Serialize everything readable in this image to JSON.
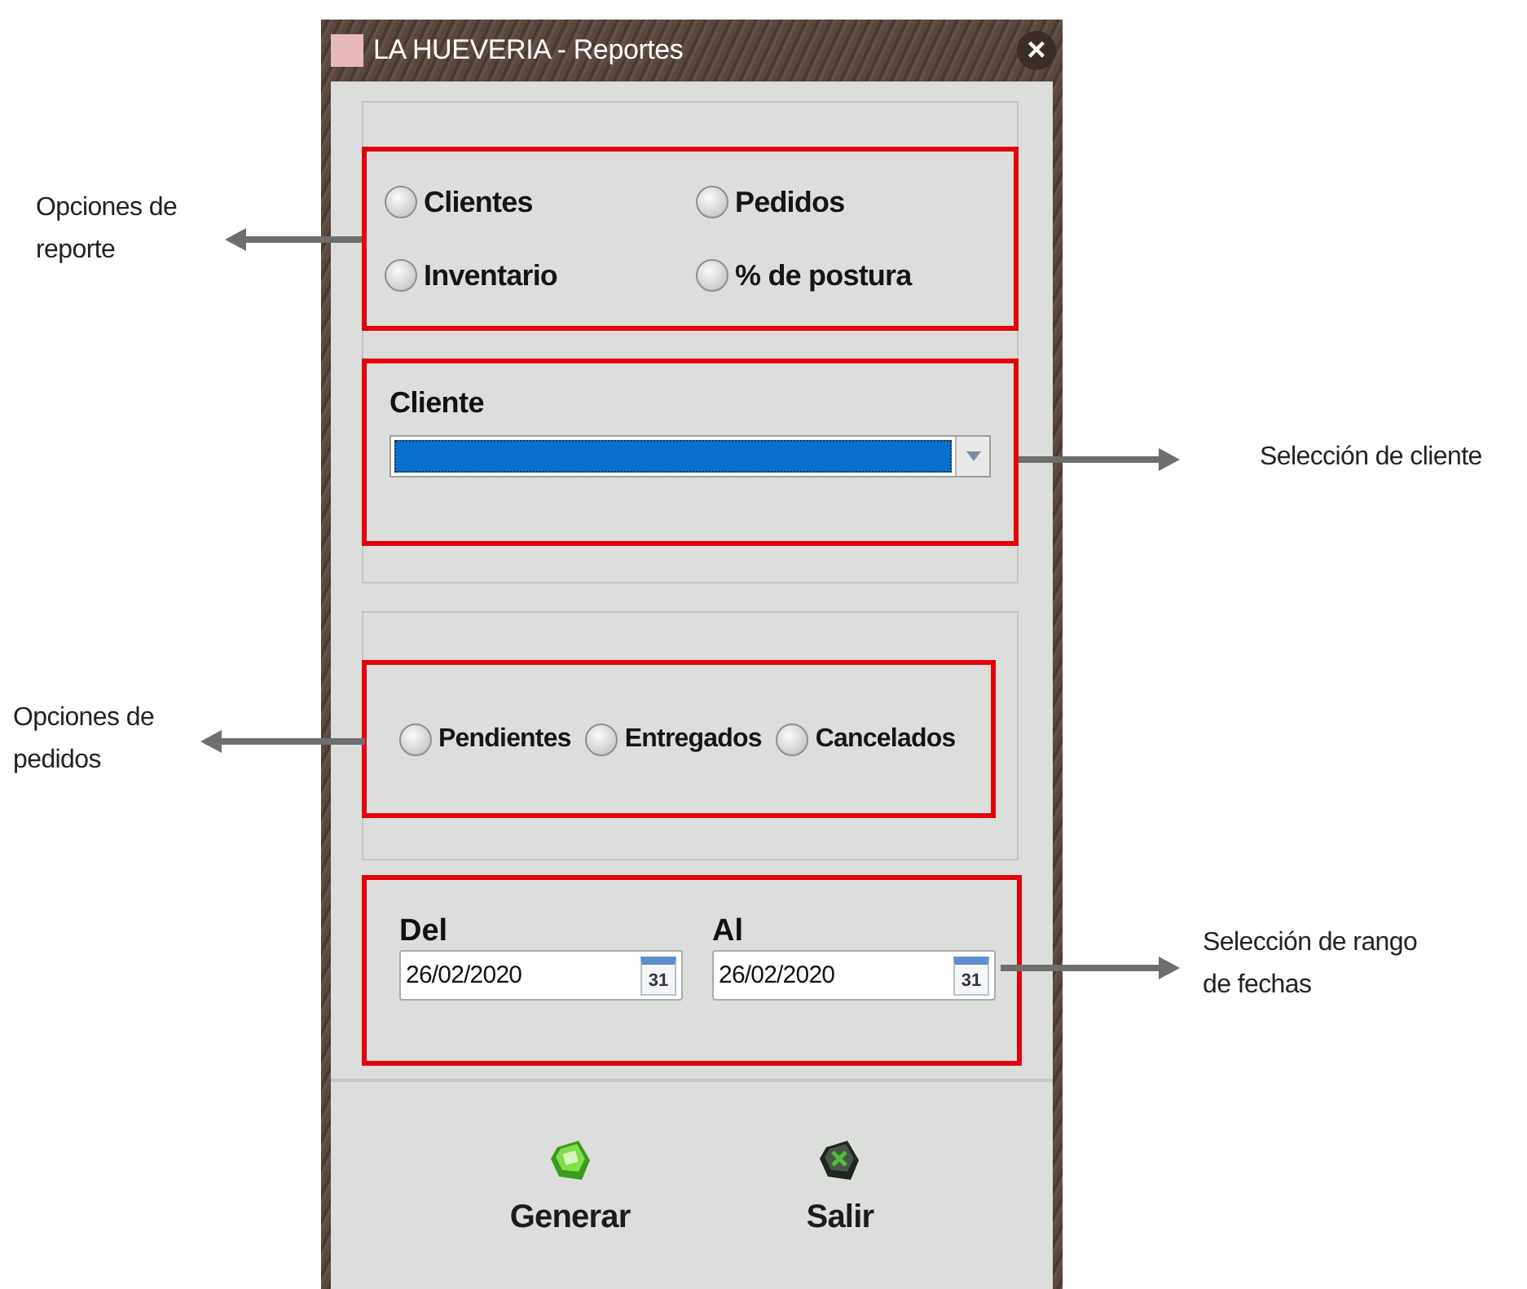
{
  "window": {
    "title": "LA HUEVERIA - Reportes",
    "close": "×"
  },
  "report_options": [
    {
      "label": "Clientes",
      "selected": false
    },
    {
      "label": "Pedidos",
      "selected": false
    },
    {
      "label": "Inventario",
      "selected": false
    },
    {
      "label": "% de postura",
      "selected": false
    }
  ],
  "client": {
    "label": "Cliente",
    "focused": true
  },
  "order_options": [
    {
      "label": "Pendientes",
      "selected": false
    },
    {
      "label": "Entregados",
      "selected": false
    },
    {
      "label": "Cancelados",
      "selected": false
    }
  ],
  "date_range": [
    {
      "label": "Del",
      "value": "26/02/2020",
      "calendar": "31"
    },
    {
      "label": "Al",
      "value": "26/02/2020",
      "calendar": "31"
    }
  ],
  "buttons": [
    {
      "label": "Generar",
      "kind": "generate"
    },
    {
      "label": "Salir",
      "kind": "exit"
    }
  ],
  "annotations": [
    {
      "text": "Opciones de\nreporte",
      "kind": "left"
    },
    {
      "text": "Selección de cliente",
      "kind": "right"
    },
    {
      "text": "Opciones de\npedidos",
      "kind": "left"
    },
    {
      "text": "Selección de rango\nde fechas",
      "kind": "right"
    }
  ]
}
